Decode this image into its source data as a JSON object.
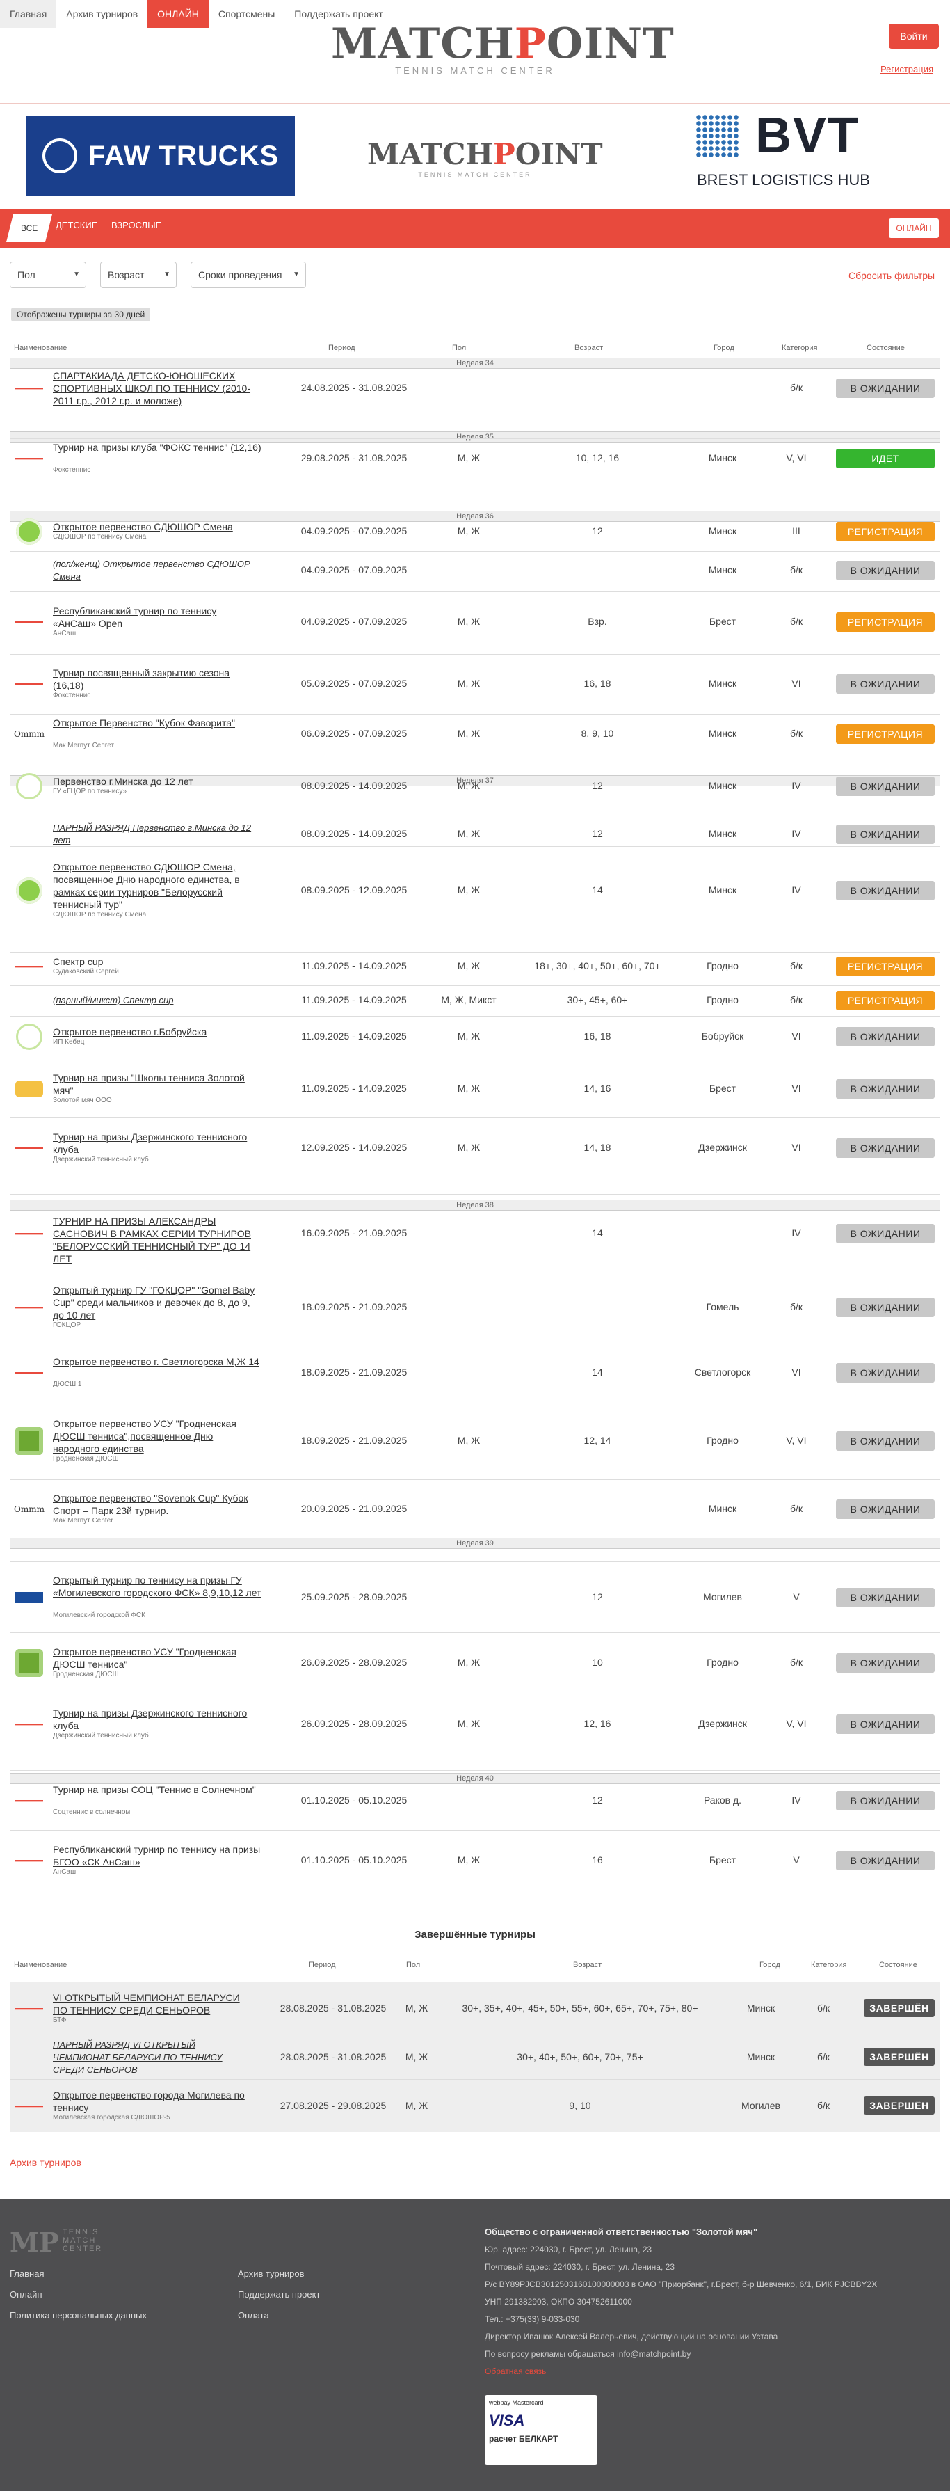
{
  "topnav": {
    "items": [
      "Главная",
      "Архив турниров",
      "ОНЛАЙН",
      "Спортсмены",
      "Поддержать проект"
    ]
  },
  "brand": {
    "name_a": "MATCH",
    "name_r": "P",
    "name_b": "OINT",
    "tagline": "TENNIS MATCH CENTER"
  },
  "auth": {
    "login": "Войти",
    "register": "Регистрация"
  },
  "sponsors": {
    "faw": "FAW TRUCKS",
    "bvt": "BVT",
    "bvt_sub": "BREST LOGISTICS HUB"
  },
  "categories": {
    "all": "ВСЕ",
    "kids": "ДЕТСКИЕ",
    "adults": "ВЗРОСЛЫЕ",
    "online": "ОНЛАЙН"
  },
  "filters": {
    "gender": "Пол",
    "age": "Возраст",
    "dates": "Сроки проведения",
    "reset": "Сбросить фильтры",
    "shown": "Отображены турниры за 30 дней"
  },
  "headers": {
    "name": "Наименование",
    "period": "Период",
    "gender": "Пол",
    "age": "Возраст",
    "city": "Город",
    "category": "Категория",
    "status": "Состояние"
  },
  "weeks": [
    "Неделя 34",
    "Неделя 35",
    "Неделя 36",
    "Неделя 37",
    "Неделя 38",
    "Неделя 39",
    "Неделя 40"
  ],
  "tournaments": [
    {
      "icon": "red",
      "name": "СПАРТАКИАДА ДЕТСКО-ЮНОШЕСКИХ СПОРТИВНЫХ ШКОЛ ПО ТЕННИСУ (2010-2011 г.р., 2012 г.р. и моложе)",
      "org": "",
      "period": "24.08.2025 - 31.08.2025",
      "gender": "",
      "age": "",
      "city": "",
      "cat": "б/к",
      "status": "В ОЖИДАНИИ",
      "st": "wait"
    },
    {
      "icon": "red",
      "name": "Турнир на призы клуба \"ФОКС теннис\" (12,16)",
      "org": "Фокстеннис",
      "period": "29.08.2025 - 31.08.2025",
      "gender": "М, Ж",
      "age": "10, 12, 16",
      "city": "Минск",
      "cat": "V, VI",
      "status": "ИДЕТ",
      "st": "go"
    },
    {
      "icon": "circ",
      "name": "Открытое первенство СДЮШОР Смена",
      "org": "СДЮШОР по теннису Смена",
      "period": "04.09.2025 - 07.09.2025",
      "gender": "М, Ж",
      "age": "12",
      "city": "Минск",
      "cat": "III",
      "status": "РЕГИСТРАЦИЯ",
      "st": "reg"
    },
    {
      "icon": "",
      "name": "(пол/женщ) Открытое первенство СДЮШОР Смена",
      "org": "",
      "period": "04.09.2025 - 07.09.2025",
      "gender": "",
      "age": "",
      "city": "Минск",
      "cat": "б/к",
      "status": "В ОЖИДАНИИ",
      "st": "wait",
      "italic": true
    },
    {
      "icon": "red",
      "name": "Республиканский турнир по теннису «АнСаш» Open",
      "org": "АнСаш",
      "period": "04.09.2025 - 07.09.2025",
      "gender": "М, Ж",
      "age": "Взр.",
      "city": "Брест",
      "cat": "б/к",
      "status": "РЕГИСТРАЦИЯ",
      "st": "reg"
    },
    {
      "icon": "red",
      "name": "Турнир посвященный закрытию сезона (16,18)",
      "org": "Фокстеннис",
      "period": "05.09.2025 - 07.09.2025",
      "gender": "М, Ж",
      "age": "16, 18",
      "city": "Минск",
      "cat": "VI",
      "status": "В ОЖИДАНИИ",
      "st": "wait"
    },
    {
      "icon": "mm",
      "name": "Открытое Первенство \"Кубок Фаворита\"",
      "org": "Мак Мегпут Сепгет",
      "period": "06.09.2025 - 07.09.2025",
      "gender": "М, Ж",
      "age": "8, 9, 10",
      "city": "Минск",
      "cat": "б/к",
      "status": "РЕГИСТРАЦИЯ",
      "st": "reg"
    },
    {
      "icon": "gy",
      "name": "Первенство г.Минска до 12 лет",
      "org": "ГУ «ГЦОР по теннису»",
      "period": "08.09.2025 - 14.09.2025",
      "gender": "М, Ж",
      "age": "12",
      "city": "Минск",
      "cat": "IV",
      "status": "В ОЖИДАНИИ",
      "st": "wait"
    },
    {
      "icon": "",
      "name": "ПАРНЫЙ РАЗРЯД Первенство г.Минска до 12 лет",
      "org": "",
      "period": "08.09.2025 - 14.09.2025",
      "gender": "М, Ж",
      "age": "12",
      "city": "Минск",
      "cat": "IV",
      "status": "В ОЖИДАНИИ",
      "st": "wait",
      "italic": true
    },
    {
      "icon": "circ",
      "name": "Открытое первенство СДЮШОР Смена, посвященное Дню народного единства, в рамках серии турниров \"Белорусский теннисный тур\"",
      "org": "СДЮШОР по теннису Смена",
      "period": "08.09.2025 - 12.09.2025",
      "gender": "М, Ж",
      "age": "14",
      "city": "Минск",
      "cat": "IV",
      "status": "В ОЖИДАНИИ",
      "st": "wait"
    },
    {
      "icon": "red",
      "name": "Спектр cup",
      "org": "Судаковский Сергей",
      "period": "11.09.2025 - 14.09.2025",
      "gender": "М, Ж",
      "age": "18+, 30+, 40+, 50+, 60+, 70+",
      "city": "Гродно",
      "cat": "б/к",
      "status": "РЕГИСТРАЦИЯ",
      "st": "reg"
    },
    {
      "icon": "",
      "name": "(парный/микст) Спектр cup",
      "org": "",
      "period": "11.09.2025 - 14.09.2025",
      "gender": "М, Ж, Микст",
      "age": "30+, 45+, 60+",
      "city": "Гродно",
      "cat": "б/к",
      "status": "РЕГИСТРАЦИЯ",
      "st": "reg",
      "italic": true
    },
    {
      "icon": "gy",
      "name": "Открытое первенство г.Бобруйска",
      "org": "ИП Кебец",
      "period": "11.09.2025 - 14.09.2025",
      "gender": "М, Ж",
      "age": "16, 18",
      "city": "Бобруйск",
      "cat": "VI",
      "status": "В ОЖИДАНИИ",
      "st": "wait"
    },
    {
      "icon": "orng",
      "name": "Турнир на призы \"Школы тенниса Золотой мяч\"",
      "org": "Золотой мяч ООО",
      "period": "11.09.2025 - 14.09.2025",
      "gender": "М, Ж",
      "age": "14, 16",
      "city": "Брест",
      "cat": "VI",
      "status": "В ОЖИДАНИИ",
      "st": "wait"
    },
    {
      "icon": "red",
      "name": "Турнир на призы Дзержинского теннисного клуба",
      "org": "Дзержинский теннисный клуб",
      "period": "12.09.2025 - 14.09.2025",
      "gender": "М, Ж",
      "age": "14, 18",
      "city": "Дзержинск",
      "cat": "VI",
      "status": "В ОЖИДАНИИ",
      "st": "wait"
    },
    {
      "icon": "red",
      "name": "ТУРНИР НА ПРИЗЫ АЛЕКСАНДРЫ САСНОВИЧ В РАМКАХ СЕРИИ ТУРНИРОВ \"БЕЛОРУССКИЙ ТЕННИСНЫЙ ТУР\" ДО 14 ЛЕТ",
      "org": "",
      "period": "16.09.2025 - 21.09.2025",
      "gender": "",
      "age": "14",
      "city": "",
      "cat": "IV",
      "status": "В ОЖИДАНИИ",
      "st": "wait"
    },
    {
      "icon": "red",
      "name": "Открытый турнир ГУ \"ГОКЦОР\" \"Gomel Baby Cup\" среди мальчиков и девочек до 8, до 9, до 10 лет",
      "org": "ГОКЦОР",
      "period": "18.09.2025 - 21.09.2025",
      "gender": "",
      "age": "",
      "city": "Гомель",
      "cat": "б/к",
      "status": "В ОЖИДАНИИ",
      "st": "wait"
    },
    {
      "icon": "red",
      "name": "Открытое первенство г. Светлогорска М,Ж 14",
      "org": "ДЮСШ 1",
      "period": "18.09.2025 - 21.09.2025",
      "gender": "",
      "age": "14",
      "city": "Светлогорск",
      "cat": "VI",
      "status": "В ОЖИДАНИИ",
      "st": "wait"
    },
    {
      "icon": "grn",
      "name": "Открытое первенство УСУ \"Гродненская ДЮСШ тенниса\",посвященное Дню народного единства",
      "org": "Гродненская ДЮСШ",
      "period": "18.09.2025 - 21.09.2025",
      "gender": "М, Ж",
      "age": "12, 14",
      "city": "Гродно",
      "cat": "V, VI",
      "status": "В ОЖИДАНИИ",
      "st": "wait"
    },
    {
      "icon": "mm",
      "name": "Открытое первенство \"Sovenok Cup\" Кубок Спорт – Парк 23й турнир.",
      "org": "Мак Мегпут Center",
      "period": "20.09.2025 - 21.09.2025",
      "gender": "",
      "age": "",
      "city": "Минск",
      "cat": "б/к",
      "status": "В ОЖИДАНИИ",
      "st": "wait"
    },
    {
      "icon": "blu",
      "name": "Открытый турнир по теннису на призы ГУ «Могилевского городского ФСК» 8,9,10,12 лет",
      "org": "Могилевский городской ФСК",
      "period": "25.09.2025 - 28.09.2025",
      "gender": "",
      "age": "12",
      "city": "Могилев",
      "cat": "V",
      "status": "В ОЖИДАНИИ",
      "st": "wait"
    },
    {
      "icon": "grn",
      "name": "Открытое первенство УСУ \"Гродненская ДЮСШ тенниса\"",
      "org": "Гродненская ДЮСШ",
      "period": "26.09.2025 - 28.09.2025",
      "gender": "М, Ж",
      "age": "10",
      "city": "Гродно",
      "cat": "б/к",
      "status": "В ОЖИДАНИИ",
      "st": "wait"
    },
    {
      "icon": "red",
      "name": "Турнир на призы Дзержинского теннисного клуба",
      "org": "Дзержинский теннисный клуб",
      "period": "26.09.2025 - 28.09.2025",
      "gender": "М, Ж",
      "age": "12, 16",
      "city": "Дзержинск",
      "cat": "V, VI",
      "status": "В ОЖИДАНИИ",
      "st": "wait"
    },
    {
      "icon": "red",
      "name": "Турнир на призы СОЦ \"Теннис в Солнечном\"",
      "org": "Соцтеннис в солнечном",
      "period": "01.10.2025 - 05.10.2025",
      "gender": "",
      "age": "12",
      "city": "Раков д.",
      "cat": "IV",
      "status": "В ОЖИДАНИИ",
      "st": "wait"
    },
    {
      "icon": "red",
      "name": "Республиканский турнир по теннису на призы БГОО «СК АнСаш»",
      "org": "АнСаш",
      "period": "01.10.2025 - 05.10.2025",
      "gender": "М, Ж",
      "age": "16",
      "city": "Брест",
      "cat": "V",
      "status": "В ОЖИДАНИИ",
      "st": "wait"
    }
  ],
  "completed": {
    "title": "Завершённые турниры",
    "rows": [
      {
        "icon": "red",
        "name": "VI ОТКРЫТЫЙ ЧЕМПИОНАТ БЕЛАРУСИ ПО ТЕННИСУ СРЕДИ СЕНЬОРОВ",
        "org": "БТФ",
        "period": "28.08.2025 - 31.08.2025",
        "gender": "М, Ж",
        "age": "30+, 35+, 40+, 45+, 50+, 55+, 60+, 65+, 70+, 75+, 80+",
        "city": "Минск",
        "cat": "б/к",
        "status": "ЗАВЕРШЁН"
      },
      {
        "icon": "",
        "name": "ПАРНЫЙ РАЗРЯД VI ОТКРЫТЫЙ ЧЕМПИОНАТ БЕЛАРУСИ ПО ТЕННИСУ СРЕДИ СЕНЬОРОВ",
        "org": "",
        "period": "28.08.2025 - 31.08.2025",
        "gender": "М, Ж",
        "age": "30+, 40+, 50+, 60+, 70+, 75+",
        "city": "Минск",
        "cat": "б/к",
        "status": "ЗАВЕРШЁН",
        "italic": true
      },
      {
        "icon": "red",
        "name": "Открытое первенство города Могилева по теннису",
        "org": "Могилевская городская СДЮШОР-5",
        "period": "27.08.2025 - 29.08.2025",
        "gender": "М, Ж",
        "age": "9, 10",
        "city": "Могилев",
        "cat": "б/к",
        "status": "ЗАВЕРШЁН"
      }
    ]
  },
  "archive_link": "Архив турниров",
  "footer": {
    "logo_text": "TENNIS MATCH CENTER",
    "col1": [
      "Главная",
      "Онлайн",
      "Политика персональных данных"
    ],
    "col2": [
      "Архив турниров",
      "Поддержать проект",
      "Оплата"
    ],
    "company": "Общество с ограниченной ответственностью \"Золотой мяч\"",
    "lines": [
      "Юр. адрес: 224030, г. Брест, ул. Ленина, 23",
      "Почтовый адрес: 224030, г. Брест, ул. Ленина, 23",
      "Р/с BY89PJCB3012503160100000003 в ОАО \"Приорбанк\", г.Брест, б-р Шевченко, 6/1, БИК PJCBBY2X",
      "УНП 291382903, ОКПО 304752611000",
      "Тел.: +375(33) 9-033-030",
      "Директор Иванюк Алексей Валерьевич, действующий на основании Устава"
    ],
    "ads": "По вопросу рекламы обращаться info@matchpoint.by",
    "feedback": "Обратная связь",
    "pay_line1": "webpay  Mastercard",
    "pay_line2": "VISA",
    "pay_line3": "расчет  БЕЛКАРТ"
  },
  "colors": {
    "accent": "#e84a3d",
    "go": "#35b52f",
    "reg": "#f39a19",
    "wait": "#c8c8c8"
  }
}
